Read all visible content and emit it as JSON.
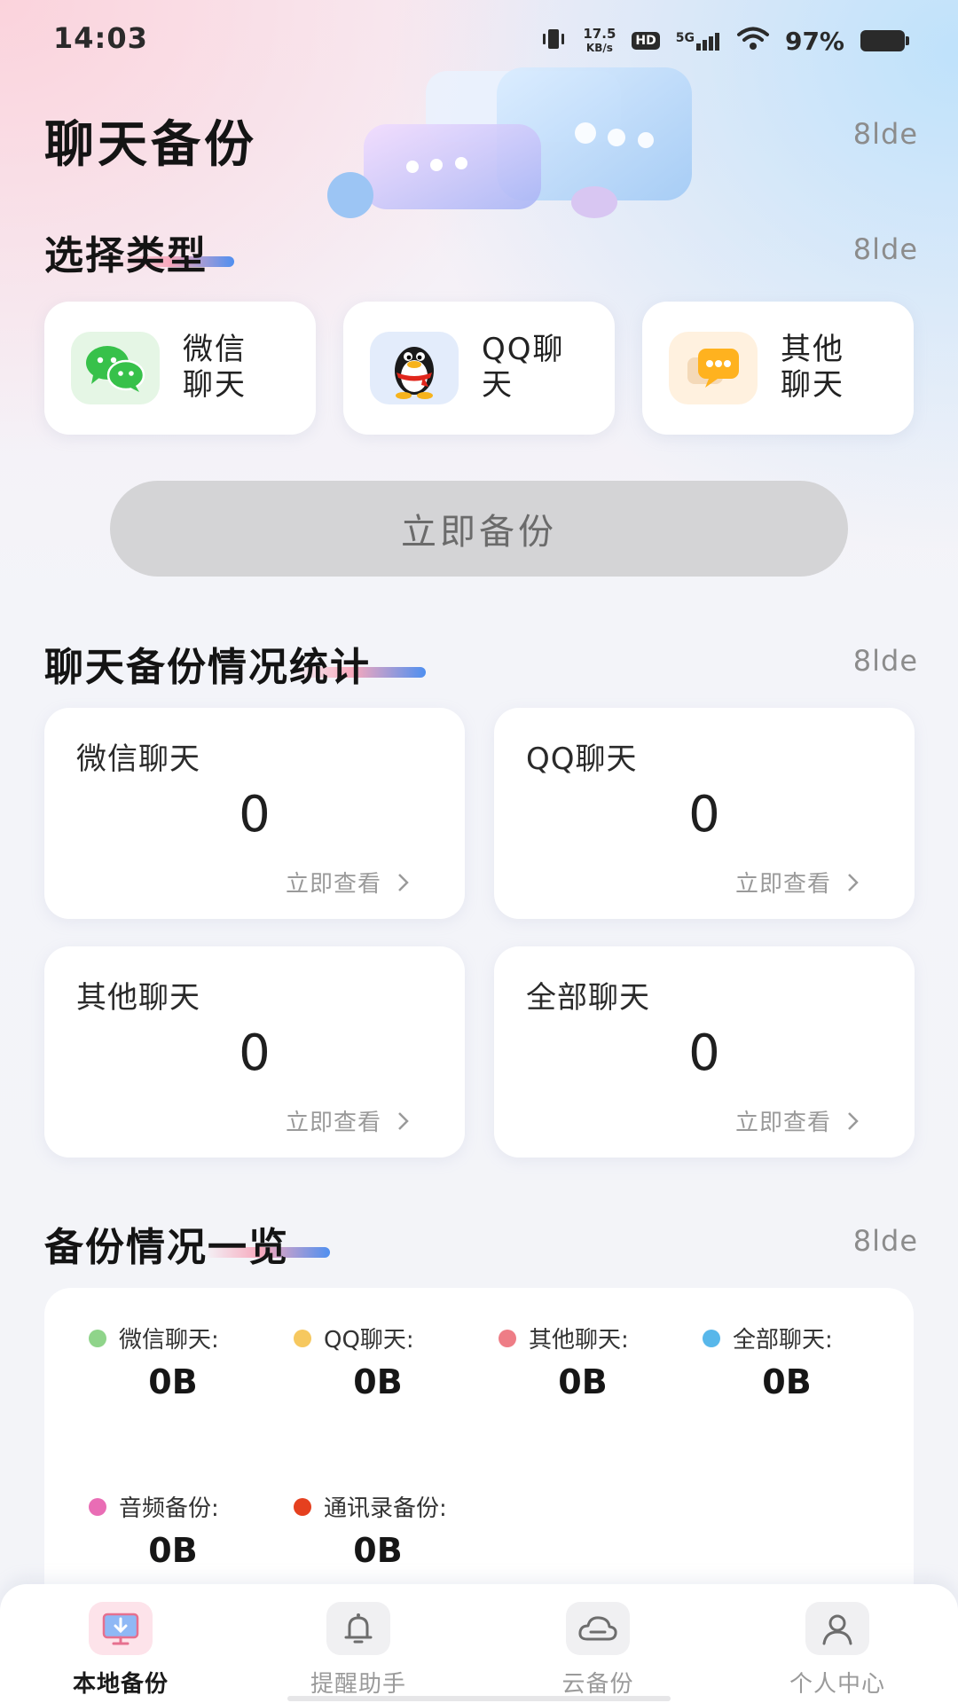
{
  "status_bar": {
    "time": "14:03",
    "net_speed_value": "17.5",
    "net_speed_unit": "KB/s",
    "hd_badge": "HD",
    "signal_label": "5G",
    "battery_text": "97%"
  },
  "header": {
    "title": "聊天备份",
    "tag": "8lde"
  },
  "type_section": {
    "title": "选择类型",
    "tag": "8lde",
    "cards": [
      {
        "label": "微信\n聊天",
        "icon": "wechat-icon"
      },
      {
        "label": "QQ聊\n天",
        "icon": "qq-penguin-icon"
      },
      {
        "label": "其他\n聊天",
        "icon": "chat-bubble-icon"
      }
    ]
  },
  "backup_button": {
    "label": "立即备份"
  },
  "stats_section": {
    "title": "聊天备份情况统计",
    "tag": "8lde",
    "cards": [
      {
        "title": "微信聊天",
        "value": "0",
        "link": "立即查看"
      },
      {
        "title": "QQ聊天",
        "value": "0",
        "link": "立即查看"
      },
      {
        "title": "其他聊天",
        "value": "0",
        "link": "立即查看"
      },
      {
        "title": "全部聊天",
        "value": "0",
        "link": "立即查看"
      }
    ]
  },
  "overview_section": {
    "title": "备份情况一览",
    "tag": "8lde",
    "items": [
      {
        "label": "微信聊天:",
        "value": "0B",
        "color": "#8fd48a"
      },
      {
        "label": "QQ聊天:",
        "value": "0B",
        "color": "#f6c85f"
      },
      {
        "label": "其他聊天:",
        "value": "0B",
        "color": "#ee7d86"
      },
      {
        "label": "全部聊天:",
        "value": "0B",
        "color": "#58b7ea"
      },
      {
        "label": "音频备份:",
        "value": "0B",
        "color": "#e96db5"
      },
      {
        "label": "通讯录备份:",
        "value": "0B",
        "color": "#e5401f"
      }
    ]
  },
  "bottom_nav": {
    "items": [
      {
        "label": "本地备份",
        "icon": "monitor-download-icon",
        "active": true
      },
      {
        "label": "提醒助手",
        "icon": "bell-icon",
        "active": false
      },
      {
        "label": "云备份",
        "icon": "cloud-icon",
        "active": false
      },
      {
        "label": "个人中心",
        "icon": "person-icon",
        "active": false
      }
    ]
  },
  "colors": {
    "accent_pink": "#f7a8bc",
    "accent_blue": "#4f8ff0",
    "button_disabled": "#d4d4d6",
    "wechat_green": "#37c14a",
    "qq_bubble_orange": "#ffb21f"
  }
}
